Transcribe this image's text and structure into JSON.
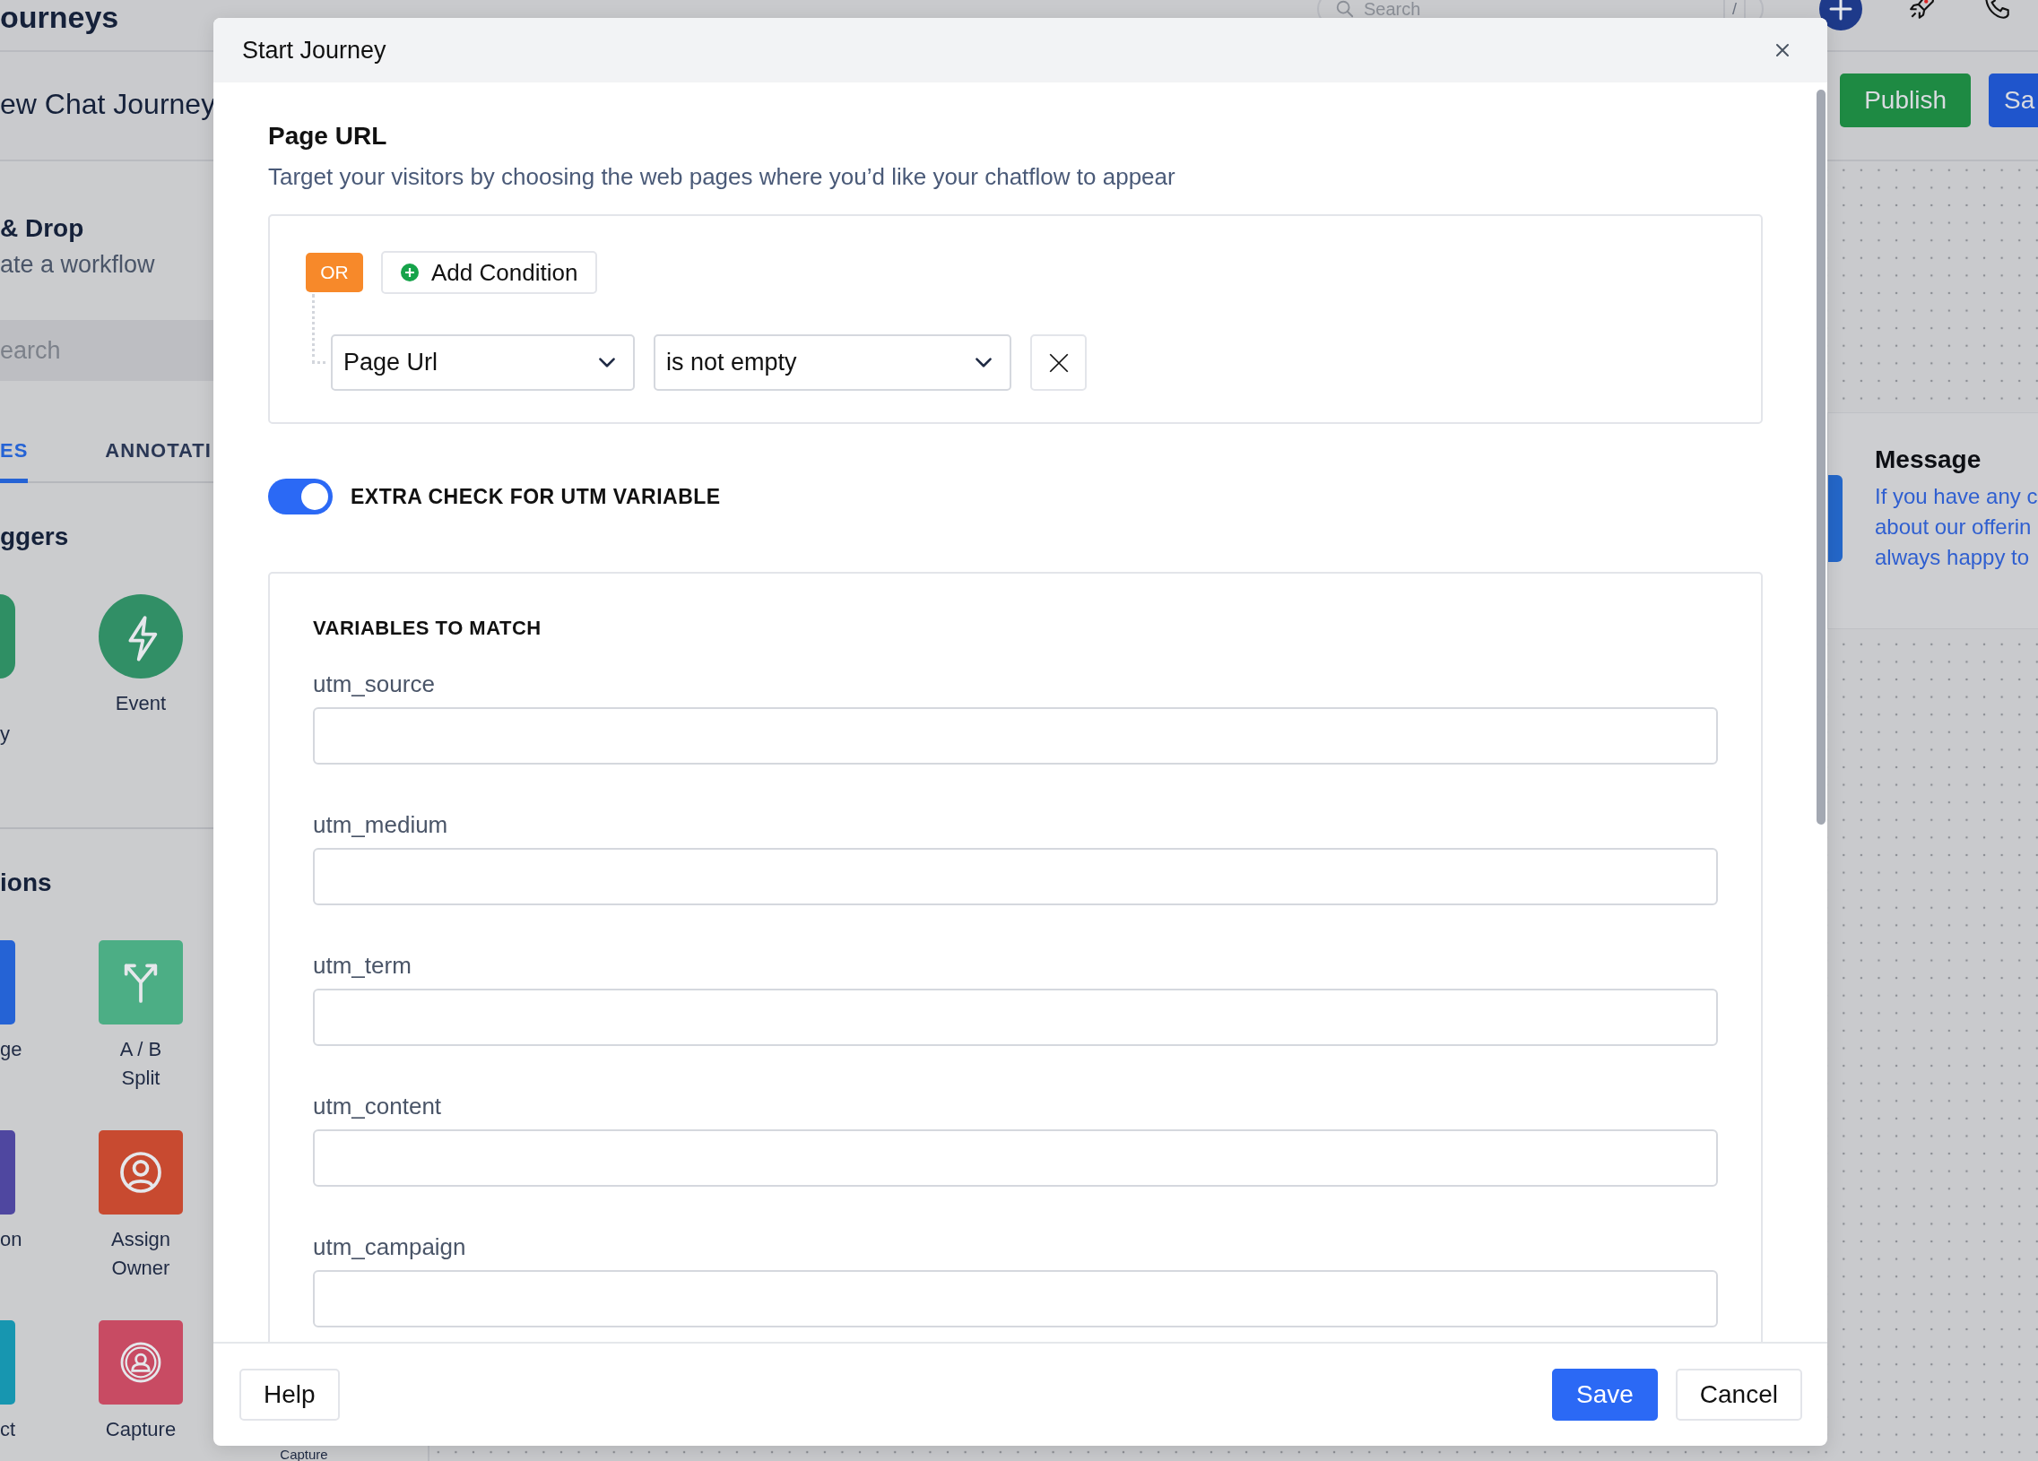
{
  "app_header": {
    "title": "ourneys",
    "search": {
      "placeholder": "Search",
      "shortcut": "/"
    }
  },
  "journey_bar": {
    "name": "ew Chat Journey",
    "buttons": [
      {
        "label": "Publish",
        "kind": "publish"
      },
      {
        "label": "Sa",
        "kind": "save"
      }
    ]
  },
  "sidebar": {
    "heading": "& Drop",
    "subheading": "ate a workflow",
    "search": {
      "placeholder": "earch"
    },
    "tabs": [
      {
        "label": "ES",
        "selected": true
      },
      {
        "label": "ANNOTATI",
        "selected": false
      }
    ],
    "sections": [
      {
        "title": "ggers",
        "kind": "triggers",
        "items": [
          {
            "label": "y",
            "kind": "partial",
            "color": "#2f8f64"
          },
          {
            "label": "Event",
            "kind": "event",
            "color": "#318f66"
          }
        ]
      },
      {
        "title": "ions",
        "kind": "actions",
        "items": [
          {
            "label": "ge",
            "kind": "partial",
            "color": "#2563d5"
          },
          {
            "label": "A / B Split",
            "kind": "split",
            "color": "#4cae85"
          },
          {
            "label": "on",
            "kind": "partial",
            "color": "#4f47a0"
          },
          {
            "label": "Assign Owner",
            "kind": "owner",
            "color": "#c84a30"
          },
          {
            "label": "ct",
            "kind": "partial",
            "color": "#1796b0"
          },
          {
            "label": "Capture",
            "kind": "capture",
            "color": "#c84b63"
          },
          {
            "label": "Capture",
            "kind": "hidden"
          }
        ]
      }
    ]
  },
  "canvas": {
    "node": {
      "title": "Message",
      "lines": [
        "If you have any c",
        "about our offerin",
        "always happy to"
      ]
    }
  },
  "modal": {
    "title": "Start Journey",
    "section": {
      "title": "Page URL",
      "description": "Target your visitors by choosing the web pages where you’d like your chatflow to appear"
    },
    "condition_group": {
      "operator": "OR",
      "add_label": "Add Condition",
      "conditions": [
        {
          "field": "Page Url",
          "operator": "is not empty"
        }
      ]
    },
    "utm_toggle": {
      "label": "EXTRA CHECK FOR UTM VARIABLE",
      "on": true
    },
    "variables": {
      "title": "VARIABLES TO MATCH",
      "fields": [
        {
          "label": "utm_source"
        },
        {
          "label": "utm_medium"
        },
        {
          "label": "utm_term"
        },
        {
          "label": "utm_content"
        },
        {
          "label": "utm_campaign"
        }
      ]
    },
    "footer": {
      "help": "Help",
      "save": "Save",
      "cancel": "Cancel"
    }
  }
}
